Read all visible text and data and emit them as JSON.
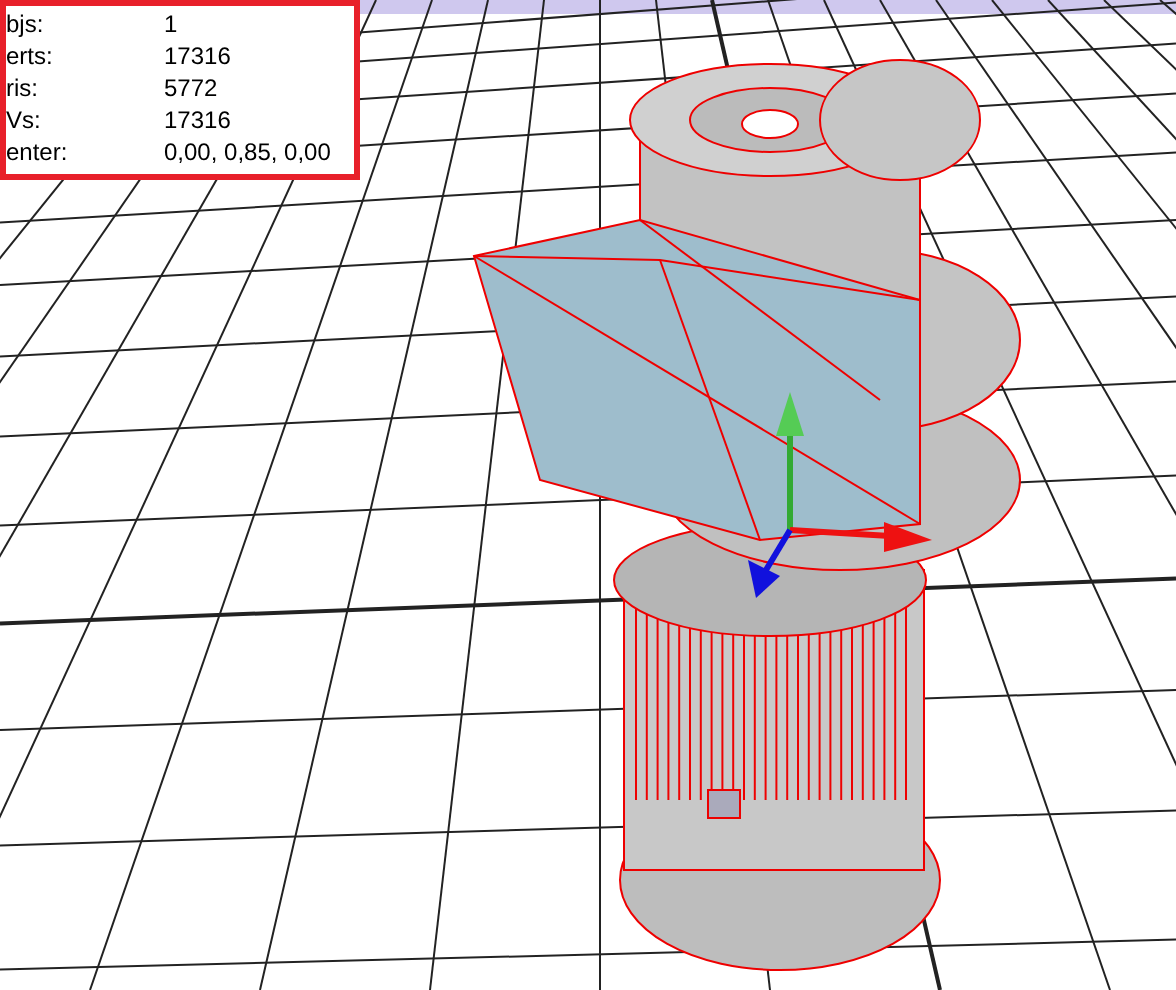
{
  "stats": [
    {
      "label": "bjs:",
      "value": "1"
    },
    {
      "label": "erts:",
      "value": "17316"
    },
    {
      "label": "ris:",
      "value": "5772"
    },
    {
      "label": "Vs:",
      "value": "17316"
    },
    {
      "label": "enter:",
      "value": "0,00, 0,85, 0,00"
    }
  ]
}
